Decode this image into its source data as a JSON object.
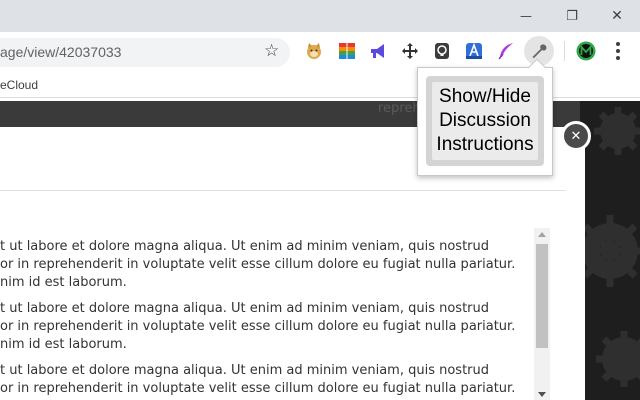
{
  "browser": {
    "url": "age/view/42037033",
    "bookmark": "eCloud",
    "window_controls": {
      "minimize": "—",
      "maximize": "❐",
      "close": "✕"
    },
    "extensions": [
      "doge-extension-icon",
      "rainbow-grid-extension-icon",
      "megaphone-extension-icon",
      "move-arrows-extension-icon",
      "lightbulb-extension-icon",
      "app-a-extension-icon",
      "feather-extension-icon",
      "wrench-extension-icon",
      "m-avatar-extension-icon",
      "menu-dots-icon"
    ]
  },
  "popup": {
    "label": "Show/Hide Discussion Instructions"
  },
  "background": {
    "partial_text": "repreh velit es"
  },
  "modal": {
    "close_label": "✕",
    "paragraphs": [
      [
        "t ut labore et dolore magna aliqua. Ut enim ad minim veniam, quis nostrud",
        "or in reprehenderit in voluptate velit esse cillum dolore eu fugiat nulla pariatur.",
        "nim id est laborum."
      ],
      [
        "t ut labore et dolore magna aliqua. Ut enim ad minim veniam, quis nostrud",
        "or in reprehenderit in voluptate velit esse cillum dolore eu fugiat nulla pariatur.",
        "nim id est laborum."
      ],
      [
        "t ut labore et dolore magna aliqua. Ut enim ad minim veniam, quis nostrud",
        "or in reprehenderit in voluptate velit esse cillum dolore eu fugiat nulla pariatur."
      ]
    ]
  },
  "colors": {
    "chrome_titlebar": "#dee1e6",
    "omnibox": "#f1f3f4",
    "overlay": "#3a3a3a",
    "popup_button": "#ebebeb"
  }
}
